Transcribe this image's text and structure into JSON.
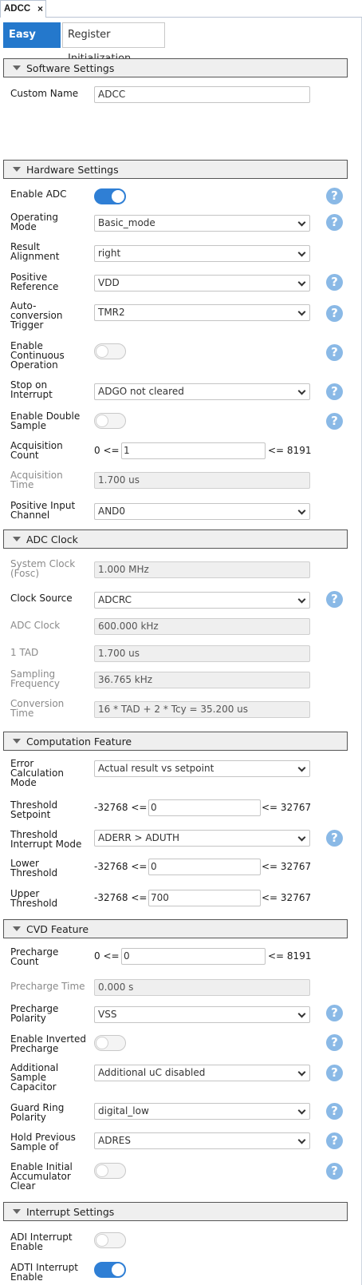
{
  "doc_tab": {
    "title": "ADCC",
    "close": "×"
  },
  "view_tabs": [
    "Easy View",
    "Register Initialization"
  ],
  "help_glyph": "?",
  "sections": {
    "software": "Software Settings",
    "hardware": "Hardware Settings",
    "adc_clock": "ADC Clock",
    "computation": "Computation Feature",
    "cvd": "CVD Feature",
    "interrupt": "Interrupt Settings"
  },
  "software": {
    "custom_name": {
      "label": "Custom Name",
      "value": "ADCC"
    }
  },
  "hardware": {
    "enable_adc": {
      "label": "Enable ADC",
      "on": true
    },
    "operating_mode": {
      "label": "Operating\nMode",
      "value": "Basic_mode"
    },
    "result_alignment": {
      "label": "Result\nAlignment",
      "value": "right"
    },
    "positive_reference": {
      "label": "Positive\nReference",
      "value": "VDD"
    },
    "autoconversion_trigger": {
      "label": "Auto-\nconversion\nTrigger",
      "value": "TMR2"
    },
    "continuous_operation": {
      "label": "Enable\nContinuous\nOperation",
      "on": false
    },
    "stop_on_interrupt": {
      "label": "Stop on\nInterrupt",
      "value": "ADGO not cleared"
    },
    "double_sample": {
      "label": "Enable Double\nSample",
      "on": false
    },
    "acquisition_count": {
      "label": "Acquisition\nCount",
      "min": "0 <=",
      "value": "1",
      "max": "<= 8191"
    },
    "acquisition_time": {
      "label": "Acquisition\nTime",
      "value": "1.700 us"
    },
    "positive_input_channel": {
      "label": "Positive Input\nChannel",
      "value": "AND0"
    }
  },
  "adc_clock": {
    "system_clock": {
      "label": "System Clock\n(Fosc)",
      "value": "1.000 MHz"
    },
    "clock_source": {
      "label": "Clock Source",
      "value": "ADCRC"
    },
    "adc_clock": {
      "label": "ADC Clock",
      "value": "600.000 kHz"
    },
    "tad": {
      "label": "1 TAD",
      "value": "1.700 us"
    },
    "sampling_frequency": {
      "label": "Sampling\nFrequency",
      "value": "36.765 kHz"
    },
    "conversion_time": {
      "label": "Conversion\nTime",
      "value": "16 * TAD + 2 * Tcy = 35.200 us"
    }
  },
  "computation": {
    "error_calc_mode": {
      "label": "Error\nCalculation\nMode",
      "value": "Actual result vs setpoint"
    },
    "threshold_setpoint": {
      "label": "Threshold\nSetpoint",
      "min": "-32768 <=",
      "value": "0",
      "max": "<= 32767"
    },
    "threshold_interrupt_mode": {
      "label": "Threshold\nInterrupt Mode",
      "value": "ADERR > ADUTH"
    },
    "lower_threshold": {
      "label": "Lower\nThreshold",
      "min": "-32768 <=",
      "value": "0",
      "max": "<= 32767"
    },
    "upper_threshold": {
      "label": "Upper\nThreshold",
      "min": "-32768 <=",
      "value": "700",
      "max": "<= 32767"
    }
  },
  "cvd": {
    "precharge_count": {
      "label": "Precharge\nCount",
      "min": "0 <=",
      "value": "0",
      "max": "<= 8191"
    },
    "precharge_time": {
      "label": "Precharge Time",
      "value": "0.000 s"
    },
    "precharge_polarity": {
      "label": "Precharge\nPolarity",
      "value": "VSS"
    },
    "inverted_precharge": {
      "label": "Enable Inverted\nPrecharge",
      "on": false
    },
    "additional_sample_cap": {
      "label": "Additional\nSample\nCapacitor",
      "value": "Additional uC disabled"
    },
    "guard_ring_polarity": {
      "label": "Guard Ring\nPolarity",
      "value": "digital_low"
    },
    "hold_previous_sample": {
      "label": "Hold Previous\nSample of",
      "value": "ADRES"
    },
    "initial_accumulator_clear": {
      "label": "Enable Initial\nAccumulator\nClear",
      "on": false
    }
  },
  "interrupt": {
    "adi_enable": {
      "label": "ADI Interrupt\nEnable",
      "on": false
    },
    "adti_enable": {
      "label": "ADTI Interrupt\nEnable",
      "on": true
    }
  }
}
